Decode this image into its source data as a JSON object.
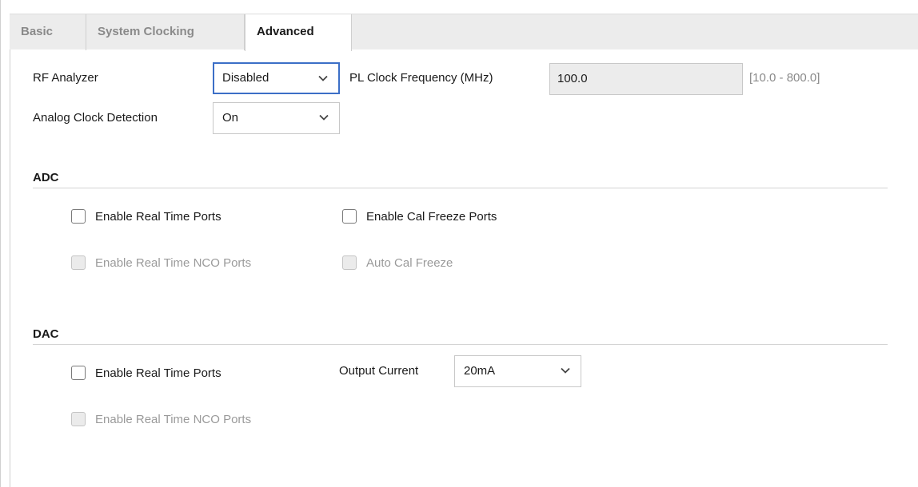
{
  "tabs": [
    {
      "label": "Basic"
    },
    {
      "label": "System Clocking"
    },
    {
      "label": "Advanced",
      "active": true
    }
  ],
  "settings": {
    "rf_analyzer_label": "RF Analyzer",
    "rf_analyzer_value": "Disabled",
    "pl_clock_label": "PL Clock Frequency (MHz)",
    "pl_clock_value": "100.0",
    "pl_clock_range": "[10.0 - 800.0]",
    "analog_clock_label": "Analog Clock Detection",
    "analog_clock_value": "On"
  },
  "adc": {
    "title": "ADC",
    "real_time_ports": "Enable Real Time Ports",
    "cal_freeze_ports": "Enable Cal Freeze Ports",
    "real_time_nco_ports": "Enable Real Time NCO Ports",
    "auto_cal_freeze": "Auto Cal Freeze"
  },
  "dac": {
    "title": "DAC",
    "real_time_ports": "Enable Real Time Ports",
    "output_current_label": "Output Current",
    "output_current_value": "20mA",
    "real_time_nco_ports": "Enable Real Time NCO Ports"
  },
  "colors": {
    "focus_border": "#3c6fc7",
    "tab_bar_bg": "#ececec",
    "disabled_text": "#9a9a9a"
  }
}
